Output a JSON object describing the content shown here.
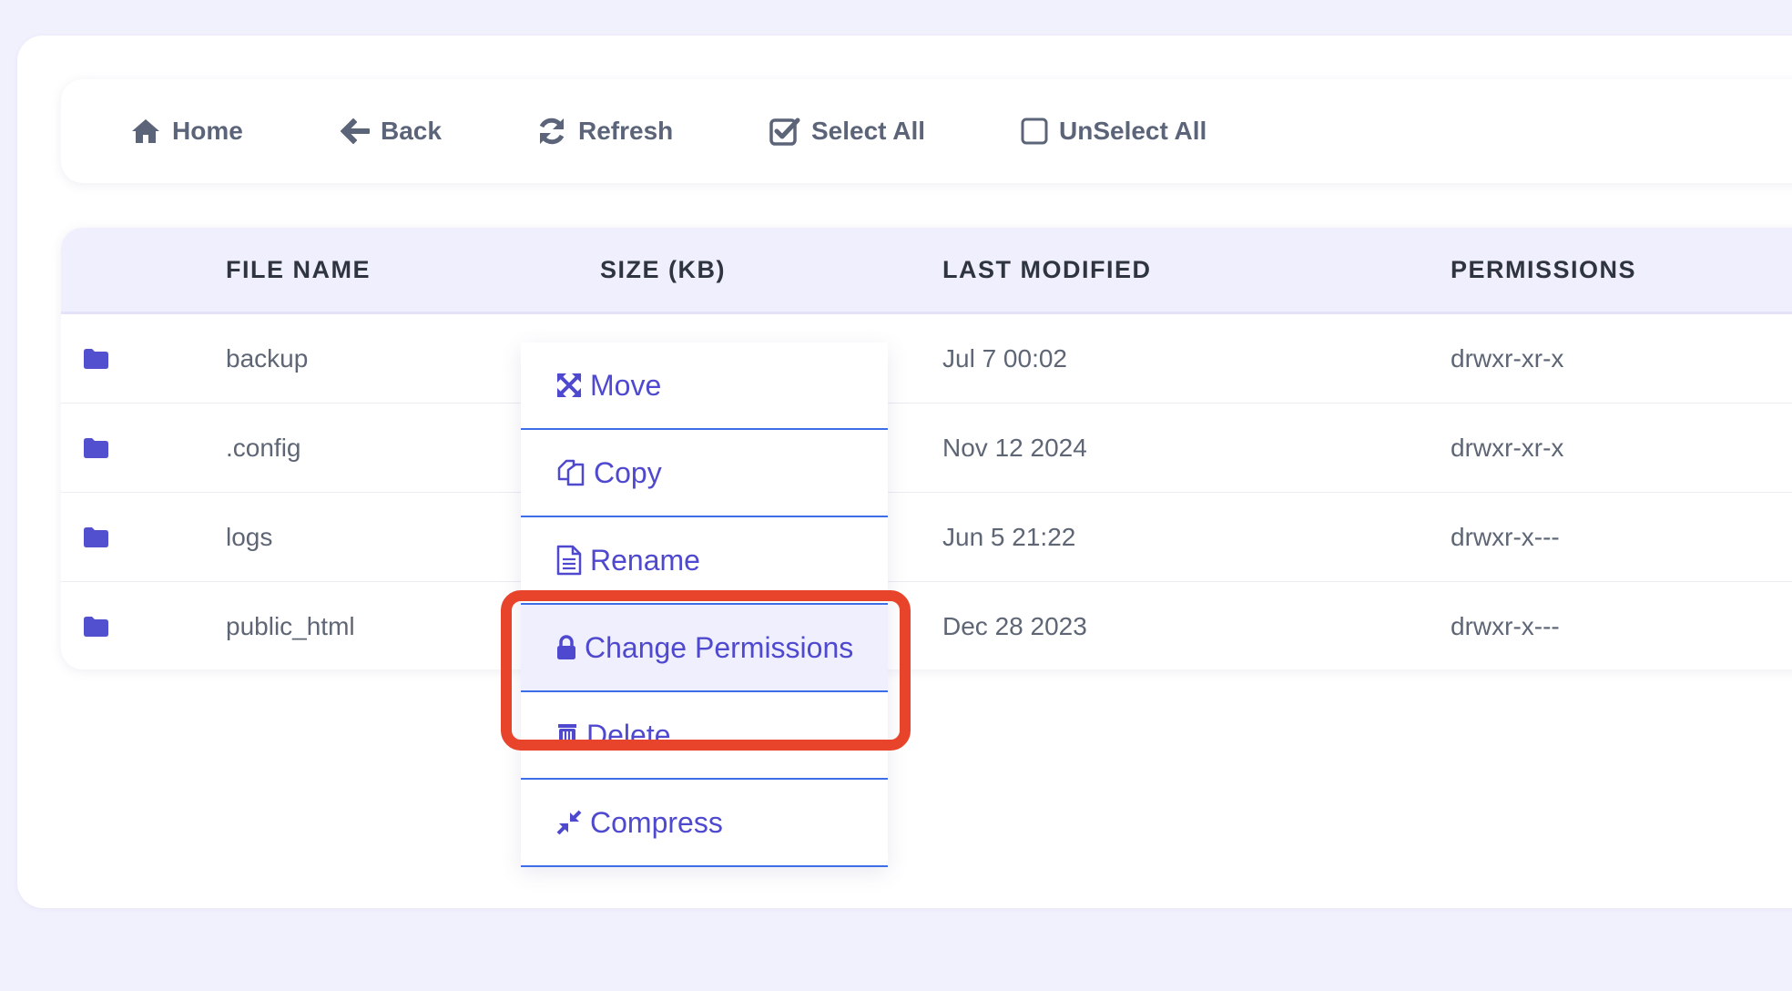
{
  "toolbar": {
    "home": "Home",
    "back": "Back",
    "refresh": "Refresh",
    "select_all": "Select All",
    "unselect_all": "UnSelect All"
  },
  "table": {
    "columns": [
      "FILE NAME",
      "SIZE (KB)",
      "LAST MODIFIED",
      "PERMISSIONS"
    ],
    "rows": [
      {
        "name": "backup",
        "size": "",
        "modified": "Jul 7 00:02",
        "permissions": "drwxr-xr-x"
      },
      {
        "name": ".config",
        "size": "",
        "modified": "Nov 12 2024",
        "permissions": "drwxr-xr-x"
      },
      {
        "name": "logs",
        "size": "",
        "modified": "Jun 5 21:22",
        "permissions": "drwxr-x---"
      },
      {
        "name": "public_html",
        "size": "",
        "modified": "Dec 28 2023",
        "permissions": "drwxr-x---"
      }
    ]
  },
  "context_menu": {
    "items": [
      {
        "label": "Move",
        "icon": "move-icon"
      },
      {
        "label": "Copy",
        "icon": "copy-icon"
      },
      {
        "label": "Rename",
        "icon": "rename-icon"
      },
      {
        "label": "Change Permissions",
        "icon": "lock-icon",
        "highlighted": true
      },
      {
        "label": "Delete",
        "icon": "trash-icon"
      },
      {
        "label": "Compress",
        "icon": "compress-icon"
      }
    ]
  },
  "colors": {
    "accent": "#4f49cf",
    "highlight_border": "#e8432b",
    "header_bg": "#f0effd",
    "page_bg": "#f1f0fd"
  }
}
